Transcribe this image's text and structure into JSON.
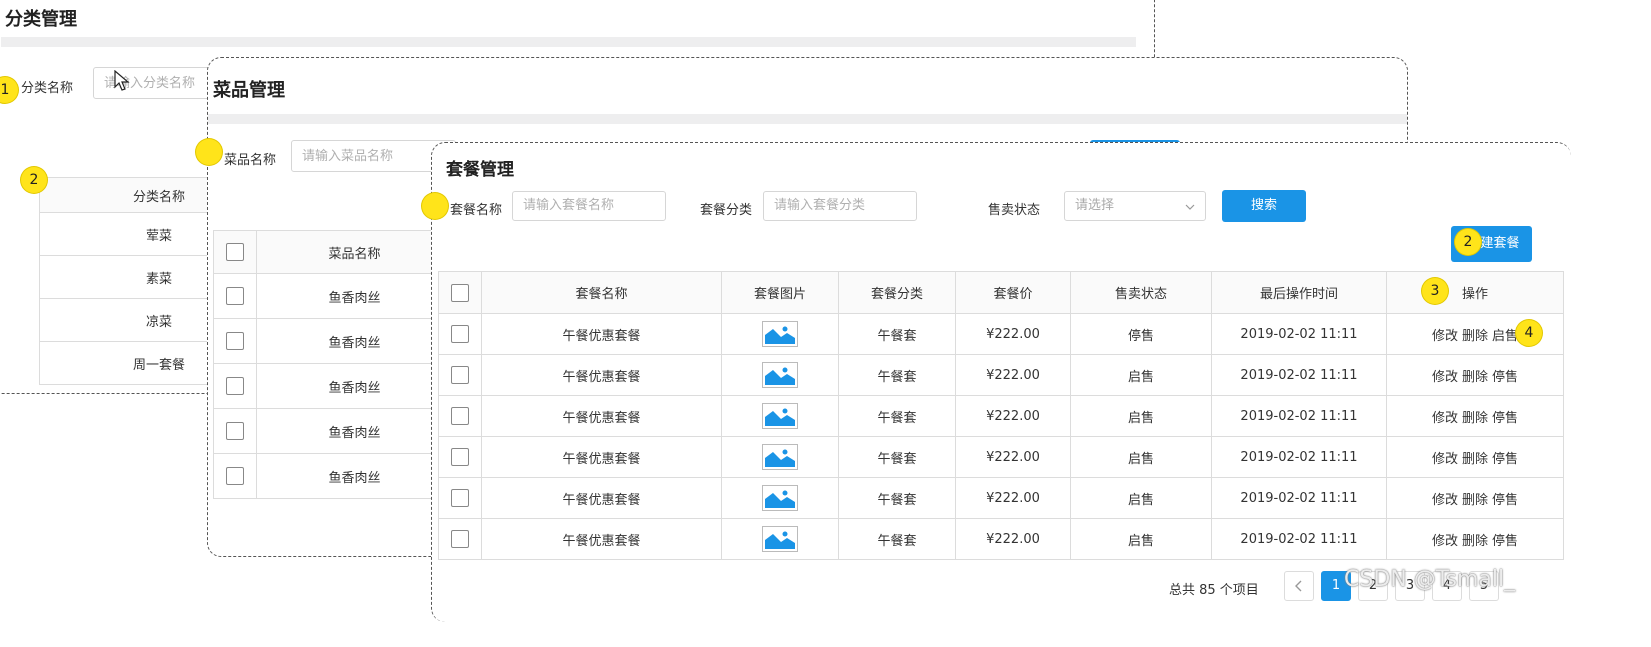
{
  "category": {
    "title": "分类管理",
    "name_label": "分类名称",
    "name_placeholder": "请输入分类名称",
    "column_name": "分类名称",
    "rows": [
      "荤菜",
      "素菜",
      "凉菜",
      "周一套餐"
    ],
    "badge1": "1",
    "badge2": "2"
  },
  "dish": {
    "title": "菜品管理",
    "name_label": "菜品名称",
    "name_placeholder": "请输入菜品名称",
    "column_name": "菜品名称",
    "rows": [
      "鱼香肉丝",
      "鱼香肉丝",
      "鱼香肉丝",
      "鱼香肉丝",
      "鱼香肉丝"
    ]
  },
  "setmeal": {
    "title": "套餐管理",
    "name_label": "套餐名称",
    "name_placeholder": "请输入套餐名称",
    "category_label": "套餐分类",
    "category_placeholder": "请输入套餐分类",
    "status_label": "售卖状态",
    "status_placeholder": "请选择",
    "search_button": "搜索",
    "new_button": "新建套餐",
    "badge2": "2",
    "badge3": "3",
    "badge4": "4",
    "columns": [
      "套餐名称",
      "套餐图片",
      "套餐分类",
      "套餐价",
      "售卖状态",
      "最后操作时间",
      "操作"
    ],
    "rows": [
      {
        "name": "午餐优惠套餐",
        "category": "午餐套",
        "price": "¥222.00",
        "status": "停售",
        "time": "2019-02-02 11:11",
        "edit": "修改",
        "delete": "删除",
        "toggle": "启售"
      },
      {
        "name": "午餐优惠套餐",
        "category": "午餐套",
        "price": "¥222.00",
        "status": "启售",
        "time": "2019-02-02 11:11",
        "edit": "修改",
        "delete": "删除",
        "toggle": "停售"
      },
      {
        "name": "午餐优惠套餐",
        "category": "午餐套",
        "price": "¥222.00",
        "status": "启售",
        "time": "2019-02-02 11:11",
        "edit": "修改",
        "delete": "删除",
        "toggle": "停售"
      },
      {
        "name": "午餐优惠套餐",
        "category": "午餐套",
        "price": "¥222.00",
        "status": "启售",
        "time": "2019-02-02 11:11",
        "edit": "修改",
        "delete": "删除",
        "toggle": "停售"
      },
      {
        "name": "午餐优惠套餐",
        "category": "午餐套",
        "price": "¥222.00",
        "status": "启售",
        "time": "2019-02-02 11:11",
        "edit": "修改",
        "delete": "删除",
        "toggle": "停售"
      },
      {
        "name": "午餐优惠套餐",
        "category": "午餐套",
        "price": "¥222.00",
        "status": "启售",
        "time": "2019-02-02 11:11",
        "edit": "修改",
        "delete": "删除",
        "toggle": "停售"
      }
    ],
    "pagination": {
      "total": "总共 85 个项目",
      "pages": [
        "1",
        "2",
        "3",
        "4",
        "5"
      ]
    }
  },
  "watermark": "CSDN @Tsmall_",
  "colors": {
    "primary": "#1a94e6",
    "badge": "#ffe41a"
  }
}
